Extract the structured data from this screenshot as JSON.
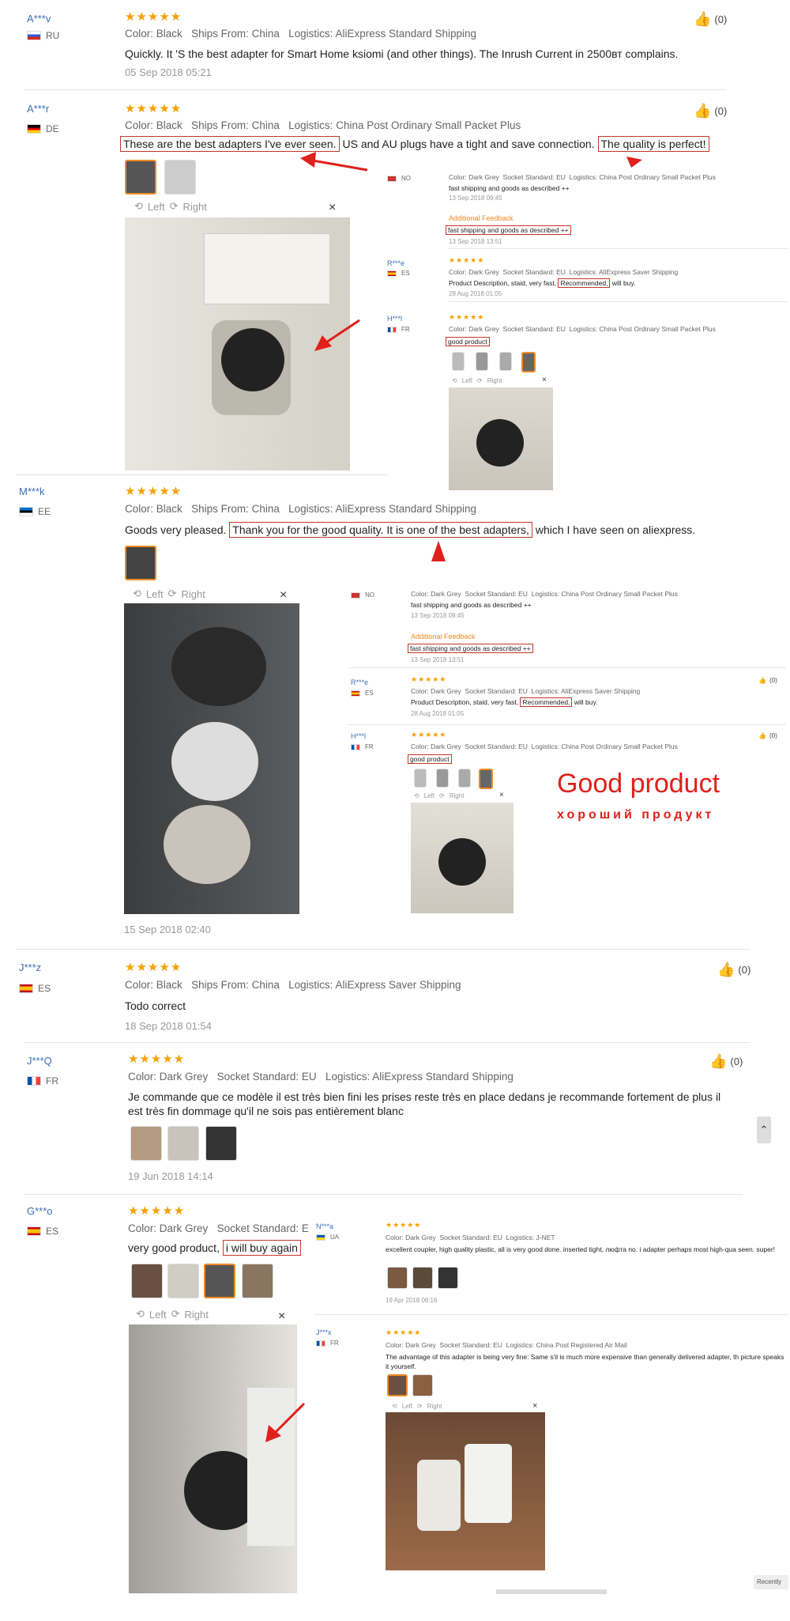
{
  "labels": {
    "color": "Color:",
    "ships": "Ships From:",
    "logistics": "Logistics:",
    "socket": "Socket Standard:"
  },
  "reviews": [
    {
      "name": "A***v",
      "country": "RU",
      "stars": "★★★★★",
      "color": "Black",
      "ships": "China",
      "logistics": "AliExpress Standard Shipping",
      "text": "Quickly. It 'S the best adapter for Smart Home ksiomi (and other things). The Inrush Current in 2500вт complains.",
      "date": "05 Sep 2018 05:21",
      "likes": "(0)"
    },
    {
      "name": "A***r",
      "country": "DE",
      "stars": "★★★★★",
      "color": "Black",
      "ships": "China",
      "logistics": "China Post Ordinary Small Packet Plus",
      "text_a": "These are the best adapters I've ever seen.",
      "text_b": "US and AU plugs have a tight and save connection.",
      "text_c": "The quality is perfect!",
      "likes": "(0)"
    },
    {
      "name": "M***k",
      "country": "EE",
      "stars": "★★★★★",
      "color": "Black",
      "ships": "China",
      "logistics": "AliExpress Standard Shipping",
      "text_a": "Goods very pleased.",
      "text_b": "Thank you for the good quality. It is one of the best adapters,",
      "text_c": "which I have seen on aliexpress.",
      "date": "15 Sep 2018 02:40"
    },
    {
      "name": "J***z",
      "country": "ES",
      "stars": "★★★★★",
      "color": "Black",
      "ships": "China",
      "logistics": "AliExpress Saver Shipping",
      "text": "Todo correct",
      "date": "18 Sep 2018 01:54",
      "likes": "(0)"
    },
    {
      "name": "J***Q",
      "country": "FR",
      "stars": "★★★★★",
      "color": "Dark Grey",
      "socket": "EU",
      "logistics": "AliExpress Standard Shipping",
      "text": "Je commande que ce modèle il est très bien fini les prises reste très en place dedans je recommande fortement de plus il est très fin dommage qu'il ne sois pas entièrement blanc",
      "date": "19 Jun 2018 14:14",
      "likes": "(0)"
    },
    {
      "name": "G***o",
      "country": "ES",
      "stars": "★★★★★",
      "color": "Dark Grey",
      "socket": "E",
      "text_a": "very good product,",
      "text_b": "i will buy again"
    }
  ],
  "viewer": {
    "left": "Left",
    "right": "Right",
    "close": "×"
  },
  "mini": {
    "no_country": "NO",
    "dark_grey": "Dark Grey",
    "eu": "EU",
    "cpo": "China Post Ordinary Small Packet Plus",
    "fast": "fast shipping and goods as described ++",
    "date1": "13 Sep 2018 09:45",
    "additional": "Additional Feedback",
    "date2": "13 Sep 2018 13:51",
    "r_name": "R***e",
    "r_country": "ES",
    "saver": "AliExpress Saver Shipping",
    "r_text_a": "Product Description, staid, very fast,",
    "r_text_b": "Recommended,",
    "r_text_c": "will buy.",
    "r_date": "28 Aug 2018 01:05",
    "h_name": "H***l",
    "h_country": "FR",
    "good": "good product",
    "likes": "(0)"
  },
  "overlay": {
    "good_en": "Good product",
    "good_ru": "хороший продукт"
  },
  "lower": {
    "n_name": "N***a",
    "n_country": "UA",
    "jnet": "J-NET",
    "n_text": "excellent coupler, high quality plastic, all is very good done. inserted tight, люфта no. i adapter perhaps most high-qua seen. super!",
    "n_date": "19 Apr 2018 06:16",
    "j_name": "J***x",
    "j_country": "FR",
    "cpr": "China Post Registered Air Mail",
    "j_text": "The advantage of this adapter is being very fine: Same s'il is much more expensive than generally delivered adapter, th picture speaks it yourself.",
    "corner": "Recently"
  },
  "colors": {
    "accent": "#f08a24",
    "star": "#f5a000",
    "link": "#3b6fb6",
    "highlight": "#c0392b",
    "red_text": "#e0201b"
  }
}
